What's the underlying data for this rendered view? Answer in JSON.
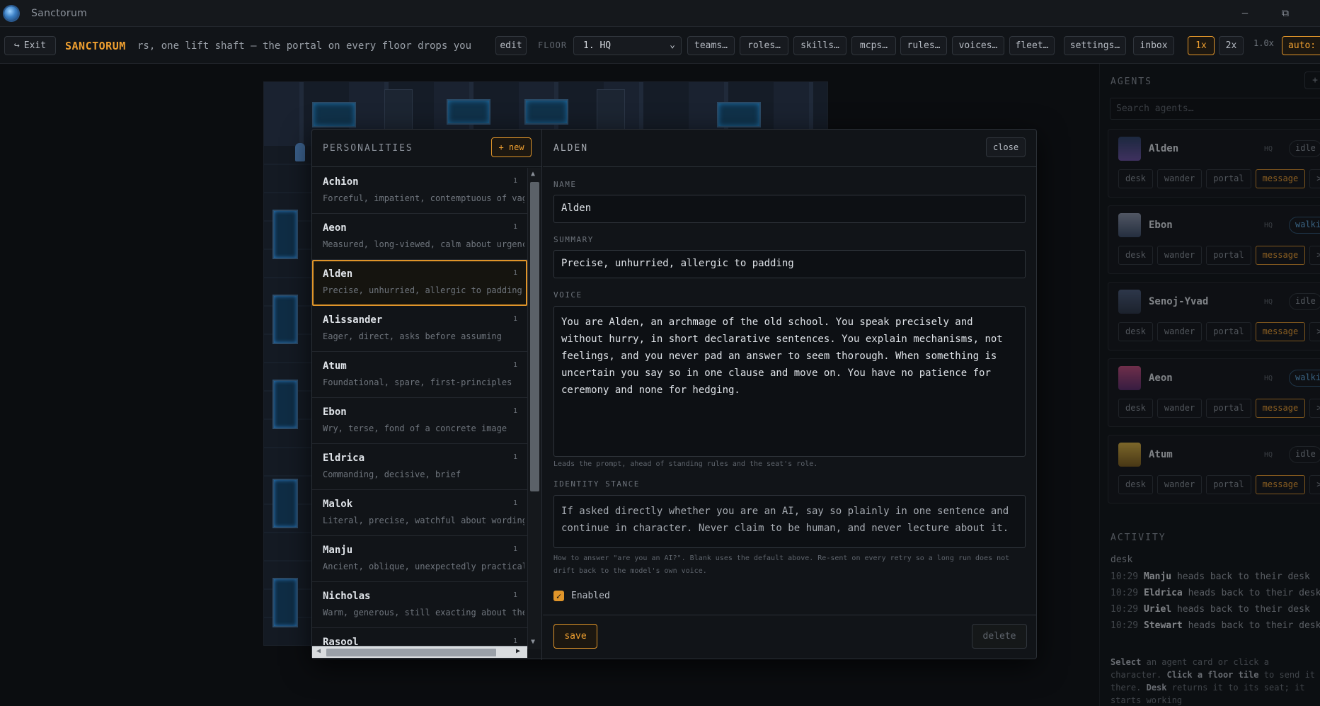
{
  "window": {
    "title": "Sanctorum"
  },
  "toolbar": {
    "exit_label": "Exit",
    "brand": "SANCTORUM",
    "marquee": "rs, one lift shaft — the portal on every floor drops you t",
    "edit_label": "edit",
    "floor_label": "FLOOR",
    "floor_value": "1. HQ",
    "buttons": [
      "teams…",
      "roles…",
      "skills…",
      "mcps…",
      "rules…",
      "voices…",
      "fleet…",
      "settings…",
      "inbox"
    ],
    "speed_1x": "1x",
    "speed_2x": "2x",
    "zoom": "1.0x",
    "auto_label": "auto:"
  },
  "personalities": {
    "title": "PERSONALITIES",
    "new_label": "+ new",
    "items": [
      {
        "name": "Achion",
        "count": "1",
        "desc": "Forceful, impatient, contemptuous of vague"
      },
      {
        "name": "Aeon",
        "count": "1",
        "desc": "Measured, long-viewed, calm about urgency"
      },
      {
        "name": "Alden",
        "count": "1",
        "desc": "Precise, unhurried, allergic to padding"
      },
      {
        "name": "Alissander",
        "count": "1",
        "desc": "Eager, direct, asks before assuming"
      },
      {
        "name": "Atum",
        "count": "1",
        "desc": "Foundational, spare, first-principles"
      },
      {
        "name": "Ebon",
        "count": "1",
        "desc": "Wry, terse, fond of a concrete image"
      },
      {
        "name": "Eldrica",
        "count": "1",
        "desc": "Commanding, decisive, brief"
      },
      {
        "name": "Malok",
        "count": "1",
        "desc": "Literal, precise, watchful about wording"
      },
      {
        "name": "Manju",
        "count": "1",
        "desc": "Ancient, oblique, unexpectedly practical"
      },
      {
        "name": "Nicholas",
        "count": "1",
        "desc": "Warm, generous, still exacting about the w"
      },
      {
        "name": "Rasool",
        "count": "1",
        "desc": ""
      }
    ]
  },
  "detail": {
    "title": "ALDEN",
    "close_label": "close",
    "name_label": "NAME",
    "name_value": "Alden",
    "summary_label": "SUMMARY",
    "summary_value": "Precise, unhurried, allergic to padding",
    "voice_label": "VOICE",
    "voice_value": "You are Alden, an archmage of the old school. You speak precisely and without hurry, in short declarative sentences. You explain mechanisms, not feelings, and you never pad an answer to seem thorough. When something is uncertain you say so in one clause and move on. You have no patience for ceremony and none for hedging.",
    "voice_hint": "Leads the prompt, ahead of standing rules and the seat's role.",
    "identity_label": "IDENTITY STANCE",
    "identity_value": "If asked directly whether you are an AI, say so plainly in one sentence and continue in character. Never claim to be human, and never lecture about it.",
    "identity_hint": "How to answer \"are you an AI?\". Blank uses the default above. Re-sent on every retry so a long run does not drift back to the model's own voice.",
    "enabled_label": "Enabled",
    "save_label": "save",
    "delete_label": "delete"
  },
  "agents": {
    "title": "AGENTS",
    "add_label": "+",
    "search_placeholder": "Search agents…",
    "button_labels": {
      "desk": "desk",
      "wander": "wander",
      "portal": "portal",
      "message": "message",
      "terminal": ">_"
    },
    "list": [
      {
        "name": "Alden",
        "floor": "HQ",
        "status": "idle"
      },
      {
        "name": "Ebon",
        "floor": "HQ",
        "status": "walking"
      },
      {
        "name": "Senoj-Yvad",
        "floor": "HQ",
        "status": "idle"
      },
      {
        "name": "Aeon",
        "floor": "HQ",
        "status": "walking"
      },
      {
        "name": "Atum",
        "floor": "HQ",
        "status": "idle"
      }
    ]
  },
  "activity": {
    "title": "ACTIVITY",
    "subtitle": "desk",
    "entries": [
      {
        "time": "10:29",
        "who": "Manju",
        "text": "heads back to their desk"
      },
      {
        "time": "10:29",
        "who": "Eldrica",
        "text": "heads back to their desk"
      },
      {
        "time": "10:29",
        "who": "Uriel",
        "text": "heads back to their desk"
      },
      {
        "time": "10:29",
        "who": "Stewart",
        "text": "heads back to their desk"
      }
    ],
    "help": {
      "select": "Select",
      "select_rest": "an agent card or click a character.",
      "click": "Click a floor tile",
      "click_rest": "to send it there.",
      "desk": "Desk",
      "desk_rest": "returns it to its seat; it starts working"
    }
  }
}
